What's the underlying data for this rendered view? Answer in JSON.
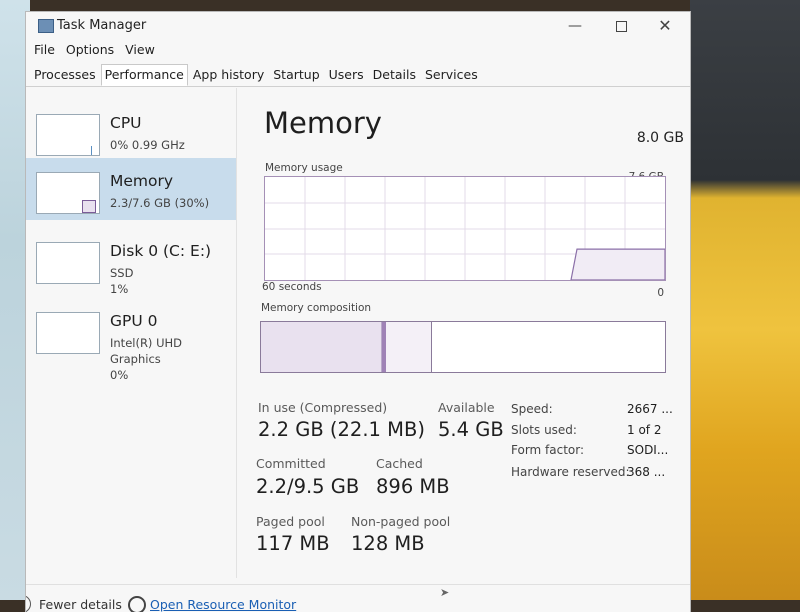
{
  "window": {
    "title": "Task Manager"
  },
  "menu": [
    "File",
    "Options",
    "View"
  ],
  "tabs": [
    "Processes",
    "Performance",
    "App history",
    "Startup",
    "Users",
    "Details",
    "Services"
  ],
  "active_tab": "Performance",
  "sidebar": [
    {
      "name": "CPU",
      "sub1": "0% 0.99 GHz",
      "sub2": ""
    },
    {
      "name": "Memory",
      "sub1": "2.3/7.6 GB (30%)",
      "sub2": ""
    },
    {
      "name": "Disk 0 (C: E:)",
      "sub1": "SSD",
      "sub2": "1%"
    },
    {
      "name": "GPU 0",
      "sub1": "Intel(R) UHD Graphics",
      "sub2": "0%"
    }
  ],
  "main": {
    "heading": "Memory",
    "total": "8.0 GB",
    "usage_label": "Memory usage",
    "usage_max": "7.6 GB",
    "time_label": "60 seconds",
    "zero_label": "0",
    "composition_label": "Memory composition",
    "stats": {
      "in_use_label": "In use (Compressed)",
      "in_use_value": "2.2 GB (22.1 MB)",
      "available_label": "Available",
      "available_value": "5.4 GB",
      "committed_label": "Committed",
      "committed_value": "2.2/9.5 GB",
      "cached_label": "Cached",
      "cached_value": "896 MB",
      "paged_label": "Paged pool",
      "paged_value": "117 MB",
      "nonpaged_label": "Non-paged pool",
      "nonpaged_value": "128 MB"
    },
    "details": [
      {
        "label": "Speed:",
        "value": "2667 ..."
      },
      {
        "label": "Slots used:",
        "value": "1 of 2"
      },
      {
        "label": "Form factor:",
        "value": "SODI..."
      },
      {
        "label": "Hardware reserved:",
        "value": "368 ..."
      }
    ]
  },
  "usage_level_fraction": 0.3,
  "composition": {
    "in_use_fraction": 0.3,
    "modified_fraction": 0.01,
    "standby_fraction": 0.1
  },
  "footer": {
    "fewer_details": "Fewer details",
    "open_monitor": "Open Resource Monitor"
  },
  "colors": {
    "accent": "#8b6fa8",
    "selected_bg": "#c8dcec",
    "link": "#1a5fb4"
  }
}
